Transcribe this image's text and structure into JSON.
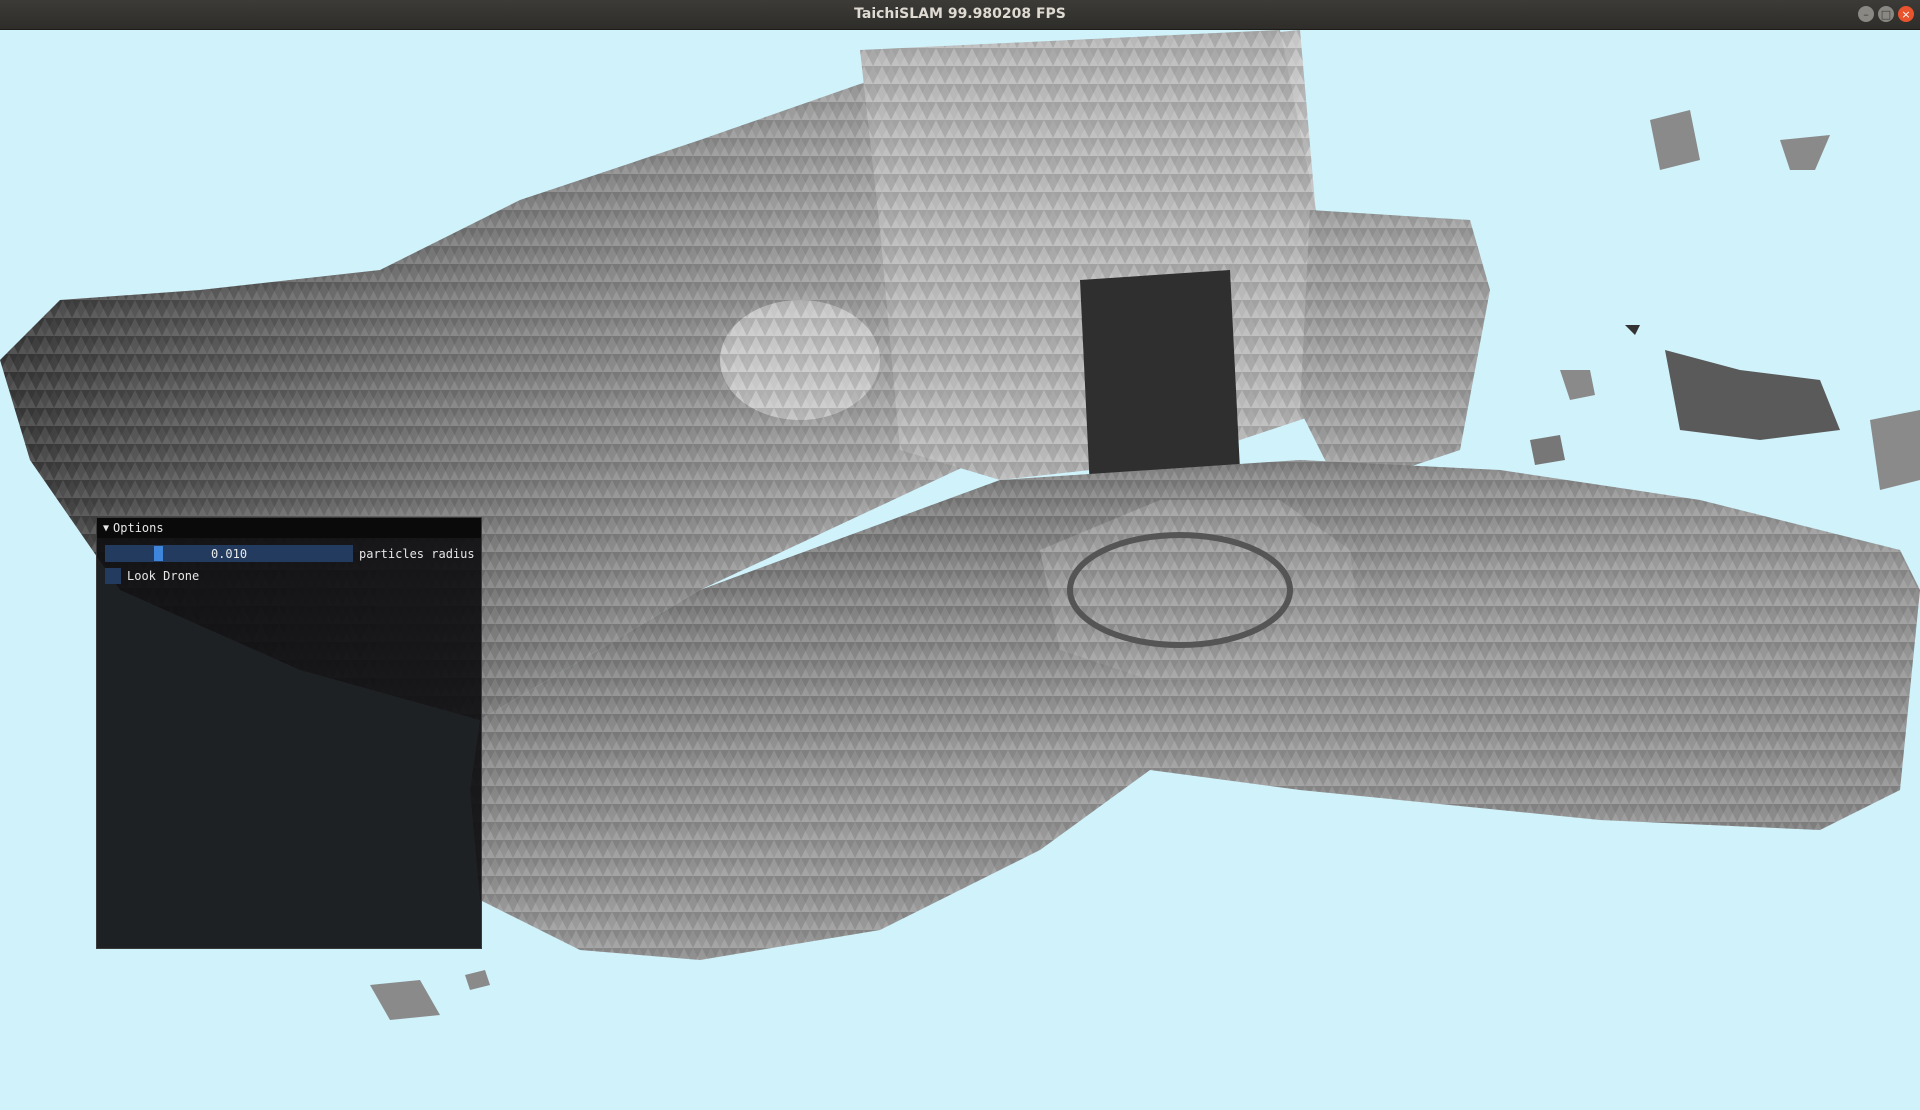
{
  "window": {
    "title": "TaichiSLAM  99.980208 FPS",
    "buttons": {
      "minimize": "–",
      "maximize": "□",
      "close": "×"
    }
  },
  "viewport": {
    "background_color": "#cff2fb",
    "mesh_color": "#8a8a8a"
  },
  "options_panel": {
    "title": "Options",
    "collapse_glyph": "▼",
    "slider": {
      "value": "0.010",
      "label": "particles radius"
    },
    "checkbox": {
      "label": "Look Drone",
      "checked": false
    }
  }
}
